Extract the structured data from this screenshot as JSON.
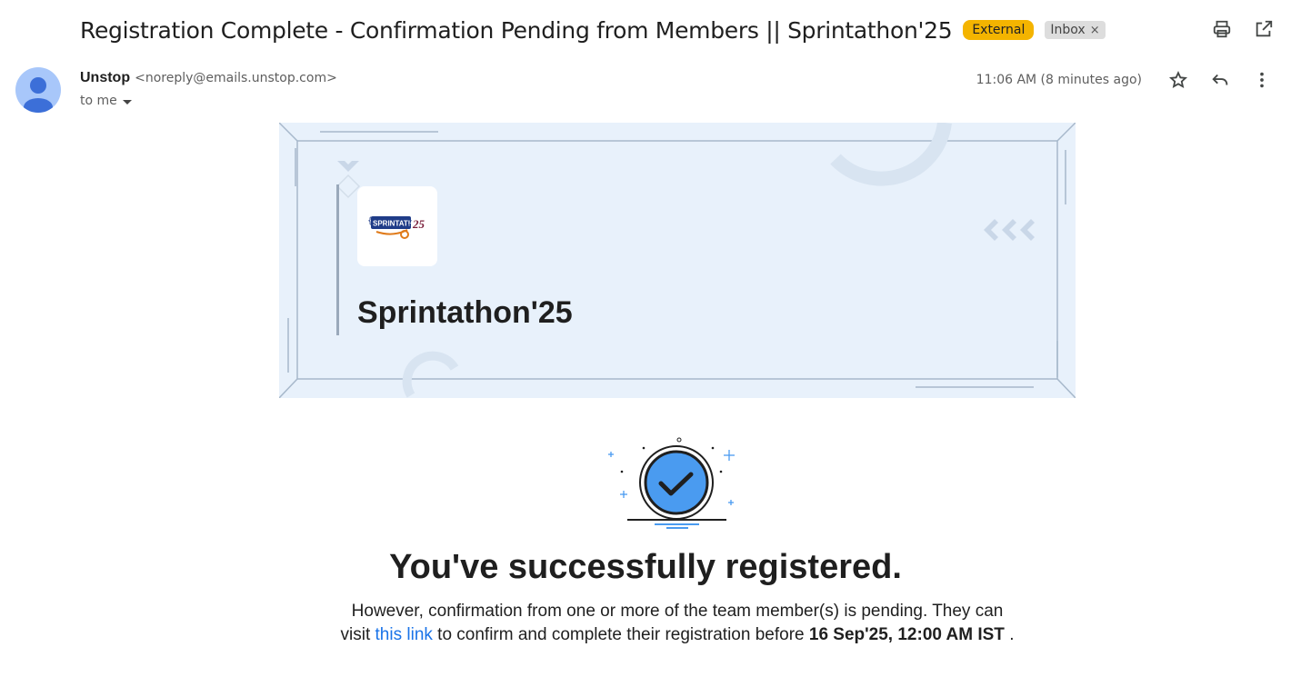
{
  "email": {
    "subject": "Registration Complete - Confirmation Pending from Members || Sprintathon'25",
    "labels": {
      "external": "External",
      "inbox": "Inbox",
      "inbox_remove": "×"
    },
    "sender": {
      "name": "Unstop",
      "email": "<noreply@emails.unstop.com>"
    },
    "recipient": "to me",
    "timestamp": "11:06 AM (8 minutes ago)"
  },
  "icons": {
    "print": "print-icon",
    "open_new_window": "open-in-new-window-icon",
    "star": "star-icon",
    "reply": "reply-icon",
    "more": "more-vert-icon"
  },
  "body": {
    "logo_text": "SPRINTATHON",
    "logo_suffix": "25",
    "event_name": "Sprintathon'25",
    "headline": "You've successfully registered.",
    "desc_part1": "However, confirmation from one or more of the team member(s) is pending. They can visit",
    "link_text": "this link",
    "desc_part2": "to confirm and complete their registration before",
    "deadline": "16 Sep'25, 12:00 AM IST",
    "desc_end": "."
  },
  "colors": {
    "external_chip": "#f4b400",
    "banner_bg": "#e8f1fb",
    "link": "#1a73e8",
    "check_circle": "#4a9bf0"
  }
}
